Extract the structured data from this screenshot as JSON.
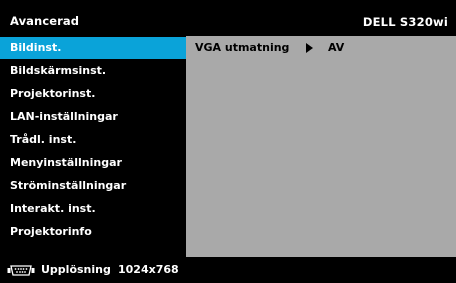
{
  "header": {
    "title": "Avancerad",
    "model": "DELL S320wi"
  },
  "sidebar": {
    "items": [
      {
        "label": "Bildinst.",
        "active": true
      },
      {
        "label": "Bildskärmsinst.",
        "active": false
      },
      {
        "label": "Projektorinst.",
        "active": false
      },
      {
        "label": "LAN-inställningar",
        "active": false
      },
      {
        "label": "Trådl. inst.",
        "active": false
      },
      {
        "label": "Menyinställningar",
        "active": false
      },
      {
        "label": "Ströminställningar",
        "active": false
      },
      {
        "label": "Interakt. inst.",
        "active": false
      },
      {
        "label": "Projektorinfo",
        "active": false
      }
    ]
  },
  "content": {
    "rows": [
      {
        "label": "VGA utmatning",
        "icon": "play-arrow-icon",
        "value": "AV"
      }
    ]
  },
  "footer": {
    "icon": "vga-connector-icon",
    "label": "Upplösning",
    "value": "1024x768"
  },
  "colors": {
    "background": "#000000",
    "highlight": "#0aa3d9",
    "content_panel": "#a9a9a9",
    "text": "#ffffff"
  }
}
